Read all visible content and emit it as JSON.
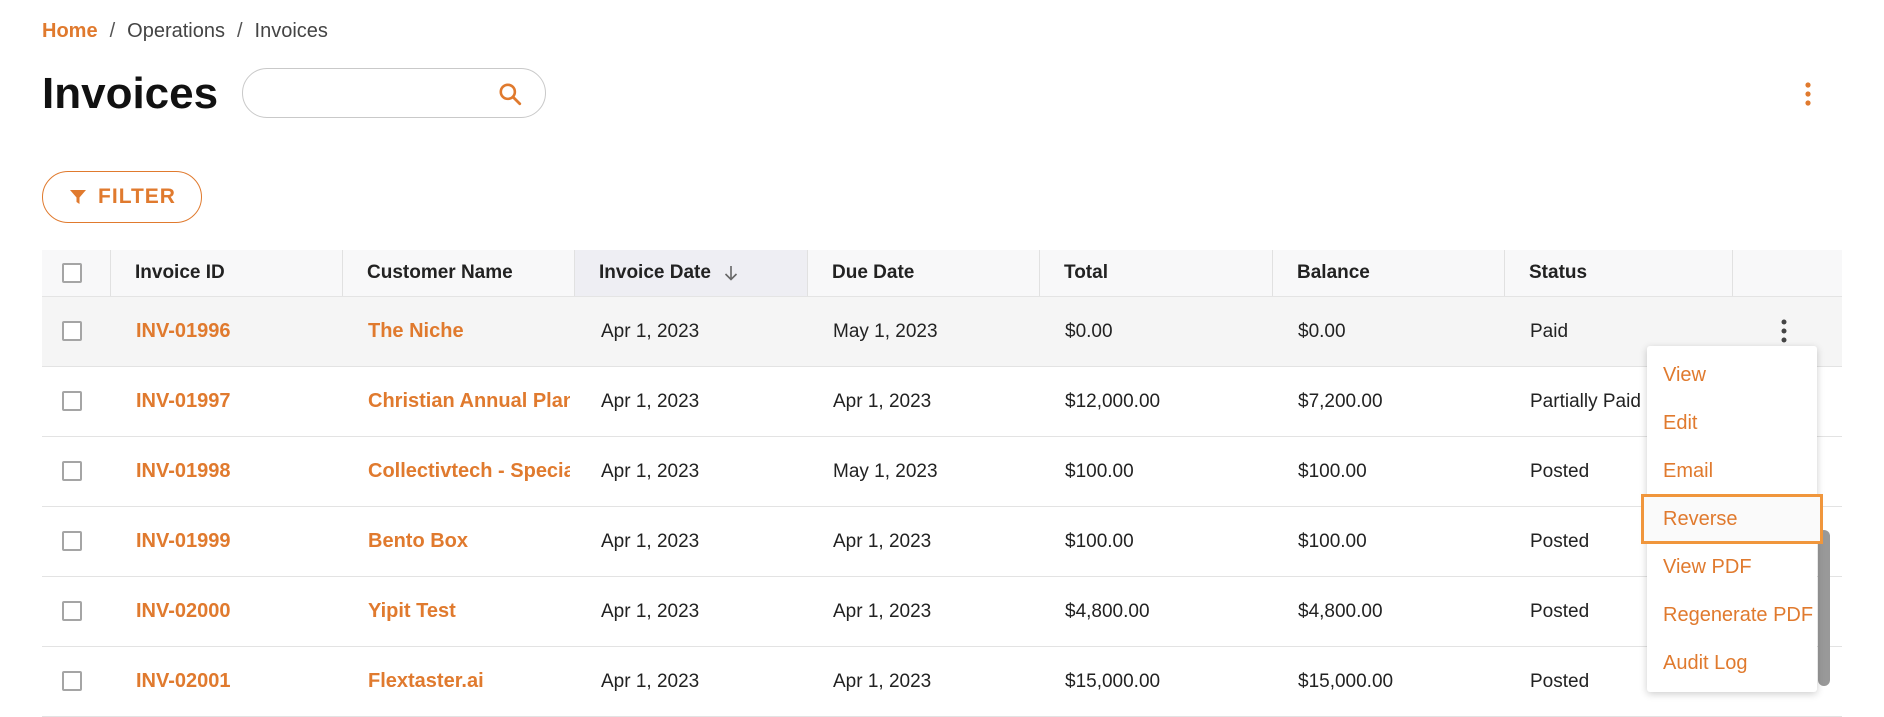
{
  "breadcrumb": {
    "home": "Home",
    "operations": "Operations",
    "current": "Invoices",
    "separator": "/"
  },
  "page_title": "Invoices",
  "search": {
    "placeholder": "",
    "value": ""
  },
  "filter_label": "FILTER",
  "table": {
    "columns": [
      "Invoice ID",
      "Customer Name",
      "Invoice Date",
      "Due Date",
      "Total",
      "Balance",
      "Status"
    ],
    "sorted_column": "Invoice Date",
    "sort_direction": "descending",
    "rows": [
      {
        "id": "INV-01996",
        "customer": "The Niche",
        "invoice_date": "Apr 1, 2023",
        "due_date": "May 1, 2023",
        "total": "$0.00",
        "balance": "$0.00",
        "status": "Paid"
      },
      {
        "id": "INV-01997",
        "customer": "Christian Annual Plan",
        "invoice_date": "Apr 1, 2023",
        "due_date": "Apr 1, 2023",
        "total": "$12,000.00",
        "balance": "$7,200.00",
        "status": "Partially Paid"
      },
      {
        "id": "INV-01998",
        "customer": "Collectivtech - Specialty",
        "invoice_date": "Apr 1, 2023",
        "due_date": "May 1, 2023",
        "total": "$100.00",
        "balance": "$100.00",
        "status": "Posted"
      },
      {
        "id": "INV-01999",
        "customer": "Bento Box",
        "invoice_date": "Apr 1, 2023",
        "due_date": "Apr 1, 2023",
        "total": "$100.00",
        "balance": "$100.00",
        "status": "Posted"
      },
      {
        "id": "INV-02000",
        "customer": "Yipit Test",
        "invoice_date": "Apr 1, 2023",
        "due_date": "Apr 1, 2023",
        "total": "$4,800.00",
        "balance": "$4,800.00",
        "status": "Posted"
      },
      {
        "id": "INV-02001",
        "customer": "Flextaster.ai",
        "invoice_date": "Apr 1, 2023",
        "due_date": "Apr 1, 2023",
        "total": "$15,000.00",
        "balance": "$15,000.00",
        "status": "Posted"
      }
    ]
  },
  "row_menu": {
    "items": [
      "View",
      "Edit",
      "Email",
      "Reverse",
      "View PDF",
      "Regenerate PDF",
      "Audit Log"
    ],
    "focused": "Reverse"
  },
  "colors": {
    "accent": "#e07a2e",
    "focus_outline": "#f0963c"
  },
  "icons": {
    "search": "search-icon",
    "filter": "filter-icon",
    "more": "more-vert-icon",
    "sort": "arrow-down-icon"
  }
}
